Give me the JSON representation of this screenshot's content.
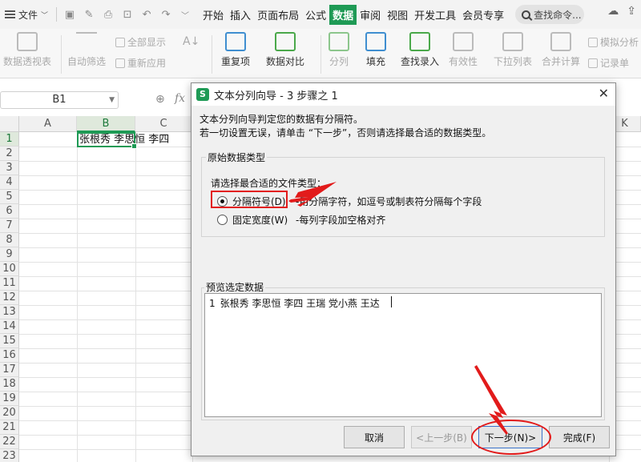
{
  "menubar": {
    "file_label": "文件",
    "tabs": [
      "开始",
      "插入",
      "页面布局",
      "公式",
      "数据",
      "审阅",
      "视图",
      "开发工具",
      "会员专享"
    ],
    "active_tab": "数据",
    "search_label": "查找命令..."
  },
  "ribbon": {
    "pivot": "数据透视表",
    "autofilter": "自动筛选",
    "show_all": "全部显示",
    "reapply": "重新应用",
    "sort_symbol": "A↓",
    "dedupe": "重复项",
    "compare": "数据对比",
    "split": "分列",
    "fill": "填充",
    "lookup": "查找录入",
    "validity": "有效性",
    "dropdown": "下拉列表",
    "consolidate": "合并计算",
    "simulate": "模拟分析",
    "record": "记录单"
  },
  "formulabar": {
    "namebox": "B1",
    "fx": "fx"
  },
  "grid": {
    "columns": [
      "A",
      "B",
      "C",
      "K"
    ],
    "rows": [
      "1",
      "2",
      "3",
      "4",
      "5",
      "6",
      "7",
      "8",
      "9",
      "10",
      "11",
      "12",
      "13",
      "14",
      "15",
      "16",
      "17",
      "18",
      "19",
      "20",
      "21",
      "22",
      "23"
    ],
    "b1_text": "张根秀  李思恒  李四"
  },
  "dialog": {
    "title": "文本分列向导 - 3 步骤之 1",
    "logo": "S",
    "intro1": "文本分列向导判定您的数据有分隔符。",
    "intro2": "若一切设置无误，请单击 “下一步”，否则请选择最合适的数据类型。",
    "group_title": "原始数据类型",
    "prompt": "请选择最合适的文件类型：",
    "option_delimited": "分隔符号(D)",
    "option_delimited_desc": "-用分隔字符，如逗号或制表符分隔每个字段",
    "option_fixed": "固定宽度(W)",
    "option_fixed_desc": "-每列字段加空格对齐",
    "preview_title": "预览选定数据",
    "preview_line_no": "1",
    "preview_text": "张根秀 李思恒 李四 王瑞 党小燕 王达",
    "btn_cancel": "取消",
    "btn_back": "<上一步(B)",
    "btn_next": "下一步(N)>",
    "btn_finish": "完成(F)"
  },
  "colors": {
    "accent_green": "#1e9a55",
    "annotation_red": "#e21b1b"
  }
}
